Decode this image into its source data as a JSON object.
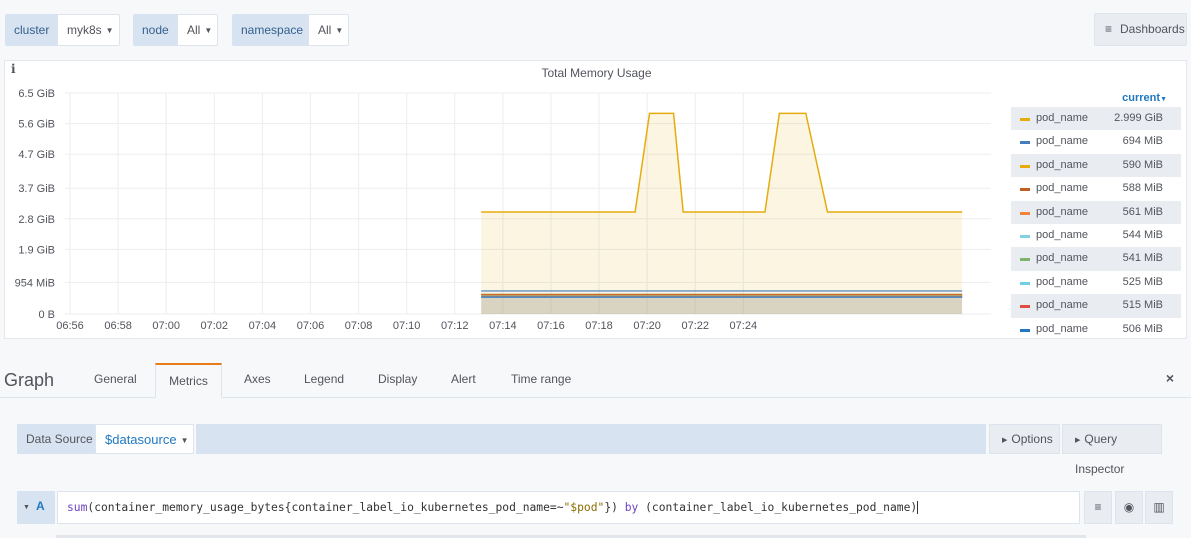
{
  "variables": [
    {
      "label": "cluster",
      "value": "myk8s"
    },
    {
      "label": "node",
      "value": "All"
    },
    {
      "label": "namespace",
      "value": "All"
    }
  ],
  "dashboards_button": "Dashboards",
  "panel": {
    "info_icon": "i",
    "title": "Total Memory Usage",
    "legend_header": "current",
    "legend": [
      {
        "name": "pod_name",
        "value": "2.999 GiB",
        "color": "#e5ac0e"
      },
      {
        "name": "pod_name",
        "value": "694 MiB",
        "color": "#447ebc"
      },
      {
        "name": "pod_name",
        "value": "590 MiB",
        "color": "#e5ac0e"
      },
      {
        "name": "pod_name",
        "value": "588 MiB",
        "color": "#bf5f22"
      },
      {
        "name": "pod_name",
        "value": "561 MiB",
        "color": "#ef843c"
      },
      {
        "name": "pod_name",
        "value": "544 MiB",
        "color": "#82d0e4"
      },
      {
        "name": "pod_name",
        "value": "541 MiB",
        "color": "#7eb26d"
      },
      {
        "name": "pod_name",
        "value": "525 MiB",
        "color": "#6ed0e0"
      },
      {
        "name": "pod_name",
        "value": "515 MiB",
        "color": "#e24d42"
      },
      {
        "name": "pod_name",
        "value": "506 MiB",
        "color": "#1f78c1"
      }
    ]
  },
  "chart_data": {
    "type": "line",
    "title": "Total Memory Usage",
    "xlabel": "",
    "ylabel": "",
    "x_ticks": [
      "06:56",
      "06:58",
      "07:00",
      "07:02",
      "07:04",
      "07:06",
      "07:08",
      "07:10",
      "07:12",
      "07:14",
      "07:16",
      "07:18",
      "07:20",
      "07:22",
      "07:24"
    ],
    "y_ticks": [
      "0 B",
      "954 MiB",
      "1.9 GiB",
      "2.8 GiB",
      "3.7 GiB",
      "4.7 GiB",
      "5.6 GiB",
      "6.5 GiB"
    ],
    "y_tick_values": [
      0,
      0.9317,
      1.9,
      2.8,
      3.7,
      4.7,
      5.6,
      6.5
    ],
    "ylim": [
      0,
      6.5
    ],
    "y_unit": "GiB",
    "x_range_minutes": [
      0,
      30.6
    ],
    "series": [
      {
        "legend_index": 0,
        "fill": true,
        "x": [
          17.1,
          23.5,
          24.1,
          25.1,
          25.5,
          27.3,
          28.9,
          29.5,
          30.6,
          31.5,
          32.1,
          33.1,
          33.5,
          37.1
        ],
        "y": [
          2.999,
          2.999,
          5.9,
          5.9,
          2.999,
          2.999,
          2.999,
          5.9,
          5.9,
          2.999,
          2.999,
          2.999,
          2.999,
          2.999
        ]
      },
      {
        "legend_index": 1,
        "x": [
          17.1,
          37.1
        ],
        "y": [
          0.678,
          0.678
        ]
      },
      {
        "legend_index": 2,
        "x": [
          17.1,
          37.1
        ],
        "y": [
          0.576,
          0.576
        ]
      },
      {
        "legend_index": 3,
        "x": [
          17.1,
          37.1
        ],
        "y": [
          0.574,
          0.574
        ]
      },
      {
        "legend_index": 4,
        "x": [
          17.1,
          37.1
        ],
        "y": [
          0.548,
          0.548
        ]
      },
      {
        "legend_index": 5,
        "x": [
          17.1,
          37.1
        ],
        "y": [
          0.531,
          0.531
        ]
      },
      {
        "legend_index": 6,
        "x": [
          17.1,
          37.1
        ],
        "y": [
          0.528,
          0.528
        ]
      },
      {
        "legend_index": 7,
        "x": [
          17.1,
          37.1
        ],
        "y": [
          0.513,
          0.513
        ]
      },
      {
        "legend_index": 8,
        "x": [
          17.1,
          37.1
        ],
        "y": [
          0.503,
          0.503
        ]
      },
      {
        "legend_index": 9,
        "x": [
          17.1,
          37.1
        ],
        "y": [
          0.494,
          0.494
        ]
      }
    ],
    "grid": true,
    "legend_position": "right"
  },
  "editor": {
    "title": "Graph",
    "tabs": [
      "General",
      "Metrics",
      "Axes",
      "Legend",
      "Display",
      "Alert",
      "Time range"
    ],
    "active_tab": "Metrics",
    "close_icon": "×"
  },
  "datasource": {
    "label": "Data Source",
    "value": "$datasource",
    "options_button": "Options",
    "inspector_button": "Query Inspector"
  },
  "query": {
    "ref": "A",
    "parts": {
      "fn": "sum",
      "p1": "(container_memory_usage_bytes{container_label_io_kubernetes_pod_name=~",
      "str": "\"$pod\"",
      "p2": "}) ",
      "kw": "by",
      "p3": " (container_label_io_kubernetes_pod_name)"
    }
  }
}
